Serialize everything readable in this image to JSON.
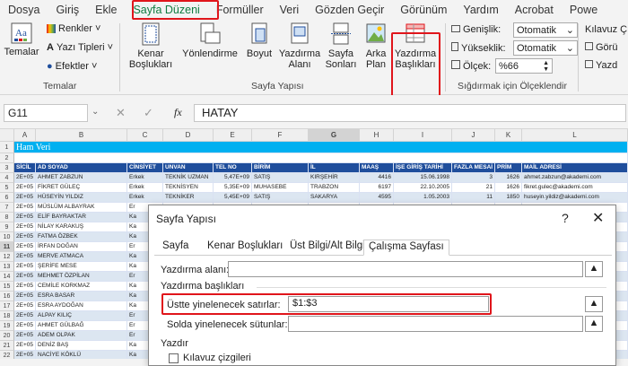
{
  "tabs": [
    "Dosya",
    "Giriş",
    "Ekle",
    "Sayfa Düzeni",
    "Formüller",
    "Veri",
    "Gözden Geçir",
    "Görünüm",
    "Yardım",
    "Acrobat",
    "Powe"
  ],
  "ribbon": {
    "themes": {
      "main_label": "Temalar",
      "colors": "Renkler",
      "fonts": "Yazı Tipleri",
      "effects": "Efektler",
      "group_label": "Temalar"
    },
    "page_setup": {
      "margins": [
        "Kenar",
        "Boşlukları"
      ],
      "orientation": [
        "Yönlendirme"
      ],
      "size": [
        "Boyut"
      ],
      "print_area": [
        "Yazdırma",
        "Alanı"
      ],
      "breaks": [
        "Sayfa",
        "Sonları"
      ],
      "background": [
        "Arka",
        "Plan"
      ],
      "print_titles": [
        "Yazdırma",
        "Başlıkları"
      ],
      "group_label": "Sayfa Yapısı"
    },
    "scale": {
      "width_label": "Genişlik:",
      "width_value": "Otomatik",
      "height_label": "Yükseklik:",
      "height_value": "Otomatik",
      "scale_label": "Ölçek:",
      "scale_value": "%66",
      "group_label": "Sığdırmak için Ölçeklendir"
    },
    "sheet_options": {
      "title": "Kılavuz Ç",
      "view": "Görü",
      "print": "Yazd"
    }
  },
  "formula_bar": {
    "name_box": "G11",
    "fx": "fx",
    "value": "HATAY"
  },
  "sheet": {
    "columns": [
      "A",
      "B",
      "C",
      "D",
      "E",
      "F",
      "G",
      "H",
      "I",
      "J",
      "K",
      "L"
    ],
    "title": "Ham Veri",
    "headers": [
      "SİCİL",
      "AD SOYAD",
      "CİNSİYET",
      "UNVAN",
      "TEL NO",
      "BİRİM",
      "İL",
      "MAAŞ",
      "İŞE GİRİŞ TARİHİ",
      "FAZLA MESAİ",
      "PRİM",
      "MAİL ADRESİ"
    ],
    "row_numbers": [
      "1",
      "2",
      "3",
      "4",
      "5",
      "6",
      "7",
      "8",
      "9",
      "10",
      "11",
      "12",
      "13",
      "14",
      "15",
      "16",
      "17",
      "18",
      "19",
      "20",
      "21",
      "22",
      "23"
    ],
    "rows": [
      [
        "2E+05",
        "AHMET ZABZUN",
        "Erkek",
        "TEKNİK UZMAN",
        "5,47E+09",
        "SATIŞ",
        "KIRŞEHİR",
        "4416",
        "15.06.1998",
        "3",
        "1626",
        "ahmet.zabzun@akademi.com"
      ],
      [
        "2E+05",
        "FİKRET GÜLEÇ",
        "Erkek",
        "TEKNİSYEN",
        "5,35E+09",
        "MUHASEBE",
        "TRABZON",
        "6197",
        "22.10.2005",
        "21",
        "1626",
        "fikret.gulec@akademi.com"
      ],
      [
        "2E+05",
        "HÜSEYİN YILDIZ",
        "Erkek",
        "TEKNİKER",
        "5,45E+09",
        "SATIŞ",
        "SAKARYA",
        "4595",
        "1.05.2003",
        "11",
        "1850",
        "huseyin.yildiz@akademi.com"
      ],
      [
        "2E+05",
        "MÜSLÜM ALBAYRAK",
        "Er",
        "",
        "",
        "",
        "",
        "",
        "",
        "",
        "",
        ""
      ],
      [
        "2E+05",
        "ELİF BAYRAKTAR",
        "Ka",
        "",
        "",
        "",
        "",
        "",
        "",
        "",
        "",
        ""
      ],
      [
        "2E+05",
        "NİLAY KARAKUŞ",
        "Ka",
        "",
        "",
        "",
        "",
        "",
        "",
        "",
        "",
        ""
      ],
      [
        "2E+05",
        "FATMA ÖZBEK",
        "Ka",
        "",
        "",
        "",
        "",
        "",
        "",
        "",
        "",
        ""
      ],
      [
        "2E+05",
        "İRFAN DOĞAN",
        "Er",
        "",
        "",
        "",
        "",
        "",
        "",
        "",
        "",
        ""
      ],
      [
        "2E+05",
        "MERVE ATMACA",
        "Ka",
        "",
        "",
        "",
        "",
        "",
        "",
        "",
        "",
        ""
      ],
      [
        "2E+05",
        "ŞERİFE MESE",
        "Ka",
        "",
        "",
        "",
        "",
        "",
        "",
        "",
        "",
        ""
      ],
      [
        "2E+05",
        "MEHMET ÖZPİLAN",
        "Er",
        "",
        "",
        "",
        "",
        "",
        "",
        "",
        "",
        ""
      ],
      [
        "2E+05",
        "CEMİLE KORKMAZ",
        "Ka",
        "",
        "",
        "",
        "",
        "",
        "",
        "",
        "",
        ""
      ],
      [
        "2E+05",
        "ESRA BASAR",
        "Ka",
        "",
        "",
        "",
        "",
        "",
        "",
        "",
        "",
        ""
      ],
      [
        "2E+05",
        "ESRA AYDOĞAN",
        "Ka",
        "",
        "",
        "",
        "",
        "",
        "",
        "",
        "",
        ""
      ],
      [
        "2E+05",
        "ALPAY KILIÇ",
        "Er",
        "",
        "",
        "",
        "",
        "",
        "",
        "",
        "",
        ""
      ],
      [
        "2E+05",
        "AHMET GÜLBAĞ",
        "Er",
        "",
        "",
        "",
        "",
        "",
        "",
        "",
        "",
        ""
      ],
      [
        "2E+05",
        "ADEM OLPAK",
        "Er",
        "",
        "",
        "",
        "",
        "",
        "",
        "",
        "",
        ""
      ],
      [
        "2E+05",
        "DENİZ BAŞ",
        "Ka",
        "",
        "",
        "",
        "",
        "",
        "",
        "",
        "",
        ""
      ],
      [
        "2E+05",
        "NACİYE KÖKLÜ",
        "Ka",
        "",
        "",
        "",
        "",
        "",
        "",
        "",
        "",
        ""
      ]
    ]
  },
  "dialog": {
    "title": "Sayfa Yapısı",
    "help": "?",
    "close": "✕",
    "tabs": [
      "Sayfa",
      "Kenar Boşlukları",
      "Üst Bilgi/Alt Bilgi",
      "Çalışma Sayfası"
    ],
    "print_area_label": "Yazdırma alanı:",
    "print_area_value": "",
    "print_titles_label": "Yazdırma başlıkları",
    "rows_repeat_label": "Üstte yinelenecek satırlar:",
    "rows_repeat_value": "$1:$3",
    "cols_repeat_label": "Solda yinelenecek sütunlar:",
    "cols_repeat_value": "",
    "print_section": "Yazdır",
    "gridlines": "Kılavuz çizgileri",
    "collapse_icon": "▲"
  },
  "colors": {
    "accent": "#107c41",
    "highlight": "#e0151b",
    "title_band": "#00b0f0",
    "header_band": "#1f4e9c",
    "row_band": "#dce6f1"
  }
}
